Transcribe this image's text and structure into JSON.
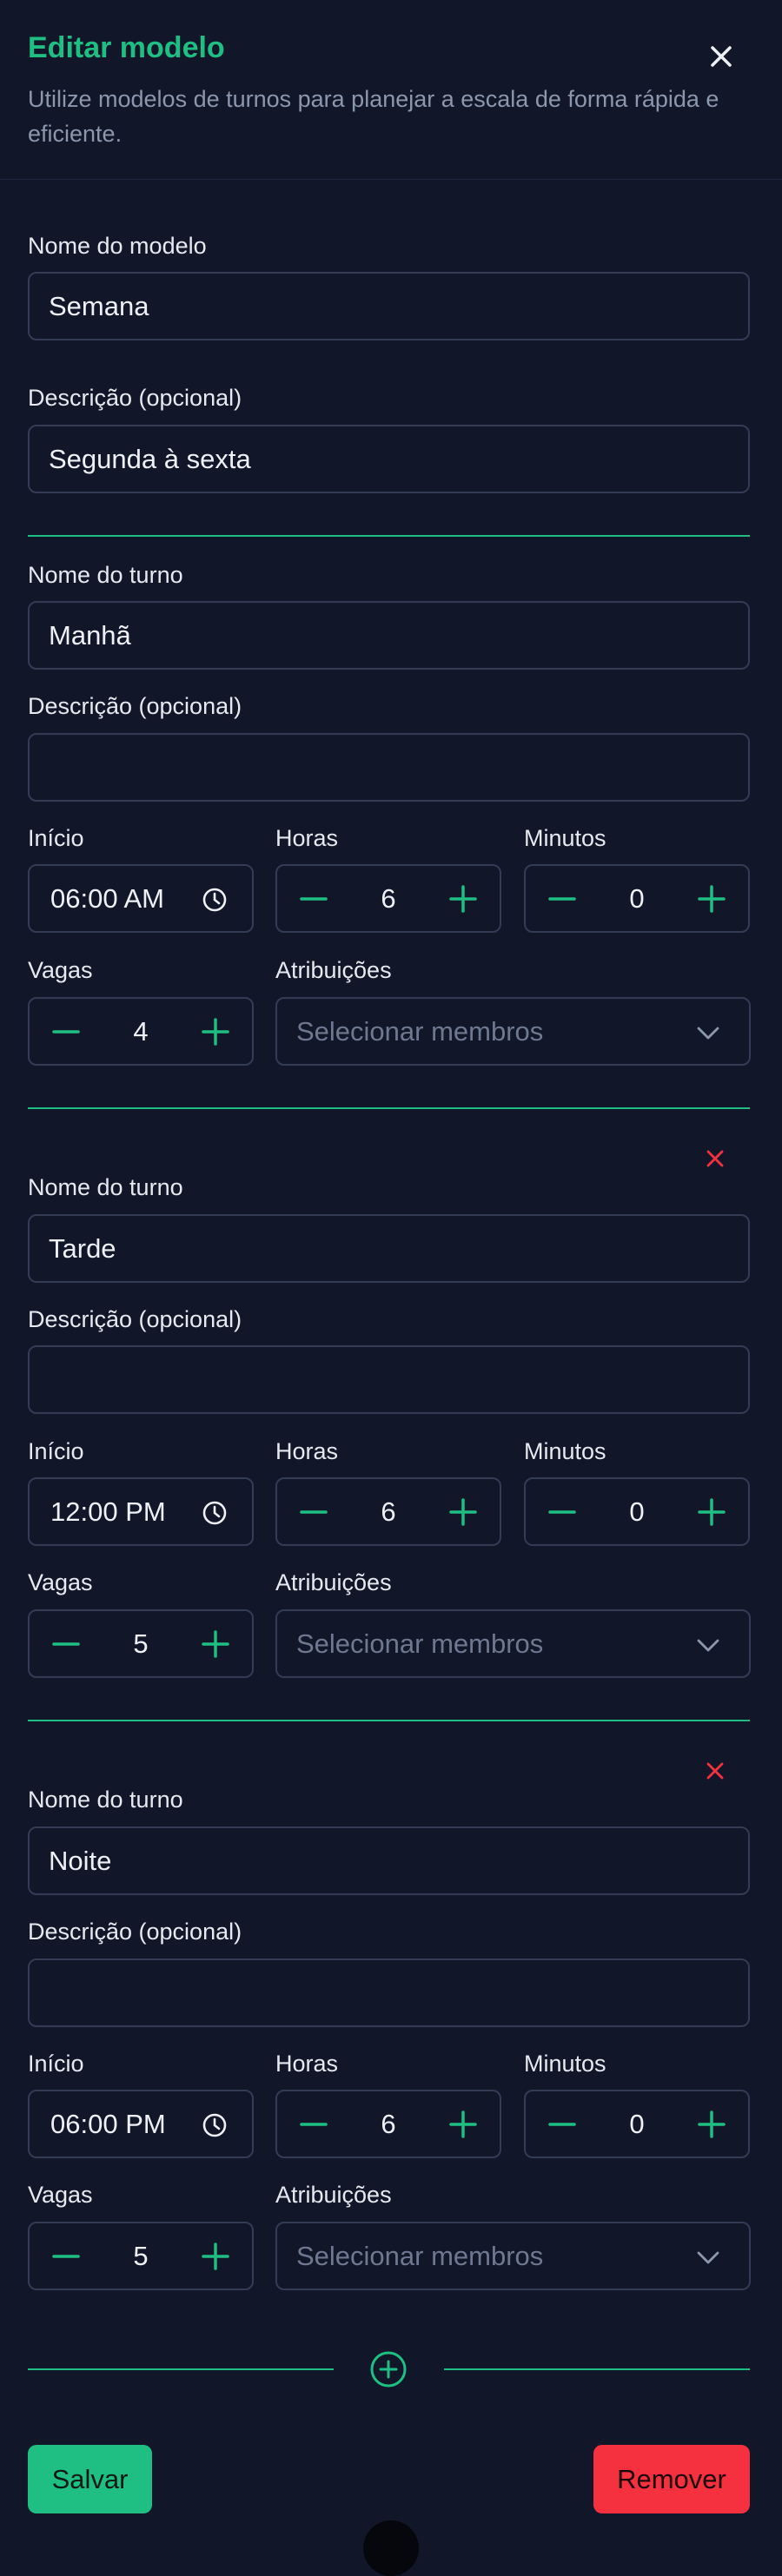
{
  "header": {
    "title": "Editar modelo",
    "subtitle": "Utilize modelos de turnos para planejar a escala de forma rápida e eficiente."
  },
  "template": {
    "name_label": "Nome do modelo",
    "name_value": "Semana",
    "description_label": "Descrição (opcional)",
    "description_value": "Segunda à sexta"
  },
  "shift_labels": {
    "name": "Nome do turno",
    "description": "Descrição (opcional)",
    "start": "Início",
    "hours": "Horas",
    "minutes": "Minutos",
    "slots": "Vagas",
    "assignments": "Atribuições",
    "assignments_placeholder": "Selecionar membros"
  },
  "shifts": [
    {
      "name": "Manhã",
      "description": "",
      "start": "06:00 AM",
      "hours": "6",
      "minutes": "0",
      "slots": "4"
    },
    {
      "name": "Tarde",
      "description": "",
      "start": "12:00 PM",
      "hours": "6",
      "minutes": "0",
      "slots": "5"
    },
    {
      "name": "Noite",
      "description": "",
      "start": "06:00 PM",
      "hours": "6",
      "minutes": "0",
      "slots": "5"
    }
  ],
  "actions": {
    "save": "Salvar",
    "remove": "Remover"
  },
  "colors": {
    "accent": "#1fbf83",
    "danger": "#f5313f",
    "background": "#111729"
  }
}
